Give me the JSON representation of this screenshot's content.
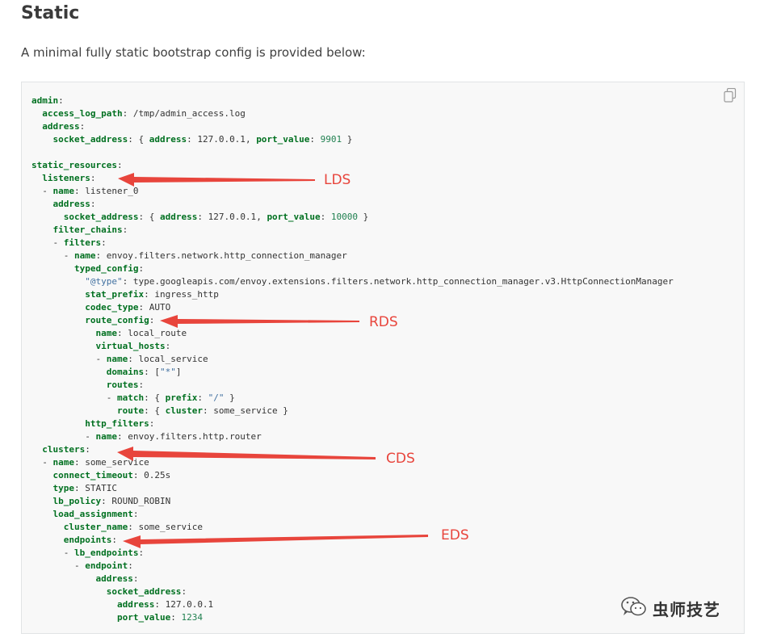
{
  "heading": "Static",
  "intro": "A minimal fully static bootstrap config is provided below:",
  "code_lines": [
    [
      [
        "k",
        "admin"
      ],
      [
        "p",
        ":"
      ]
    ],
    [
      [
        "p",
        "  "
      ],
      [
        "k",
        "access_log_path"
      ],
      [
        "p",
        ": "
      ],
      [
        "v",
        "/tmp/admin_access.log"
      ]
    ],
    [
      [
        "p",
        "  "
      ],
      [
        "k",
        "address"
      ],
      [
        "p",
        ":"
      ]
    ],
    [
      [
        "p",
        "    "
      ],
      [
        "k",
        "socket_address"
      ],
      [
        "p",
        ": { "
      ],
      [
        "k",
        "address"
      ],
      [
        "p",
        ": "
      ],
      [
        "v",
        "127.0.0.1"
      ],
      [
        "p",
        ", "
      ],
      [
        "k",
        "port_value"
      ],
      [
        "p",
        ": "
      ],
      [
        "n",
        "9901"
      ],
      [
        "p",
        " }"
      ]
    ],
    [],
    [
      [
        "k",
        "static_resources"
      ],
      [
        "p",
        ":"
      ]
    ],
    [
      [
        "p",
        "  "
      ],
      [
        "k",
        "listeners"
      ],
      [
        "p",
        ":"
      ]
    ],
    [
      [
        "p",
        "  - "
      ],
      [
        "k",
        "name"
      ],
      [
        "p",
        ": "
      ],
      [
        "v",
        "listener_0"
      ]
    ],
    [
      [
        "p",
        "    "
      ],
      [
        "k",
        "address"
      ],
      [
        "p",
        ":"
      ]
    ],
    [
      [
        "p",
        "      "
      ],
      [
        "k",
        "socket_address"
      ],
      [
        "p",
        ": { "
      ],
      [
        "k",
        "address"
      ],
      [
        "p",
        ": "
      ],
      [
        "v",
        "127.0.0.1"
      ],
      [
        "p",
        ", "
      ],
      [
        "k",
        "port_value"
      ],
      [
        "p",
        ": "
      ],
      [
        "n",
        "10000"
      ],
      [
        "p",
        " }"
      ]
    ],
    [
      [
        "p",
        "    "
      ],
      [
        "k",
        "filter_chains"
      ],
      [
        "p",
        ":"
      ]
    ],
    [
      [
        "p",
        "    - "
      ],
      [
        "k",
        "filters"
      ],
      [
        "p",
        ":"
      ]
    ],
    [
      [
        "p",
        "      - "
      ],
      [
        "k",
        "name"
      ],
      [
        "p",
        ": "
      ],
      [
        "v",
        "envoy.filters.network.http_connection_manager"
      ]
    ],
    [
      [
        "p",
        "        "
      ],
      [
        "k",
        "typed_config"
      ],
      [
        "p",
        ":"
      ]
    ],
    [
      [
        "p",
        "          "
      ],
      [
        "s",
        "\"@type\""
      ],
      [
        "p",
        ": "
      ],
      [
        "v",
        "type.googleapis.com/envoy.extensions.filters.network.http_connection_manager.v3.HttpConnectionManager"
      ]
    ],
    [
      [
        "p",
        "          "
      ],
      [
        "k",
        "stat_prefix"
      ],
      [
        "p",
        ": "
      ],
      [
        "v",
        "ingress_http"
      ]
    ],
    [
      [
        "p",
        "          "
      ],
      [
        "k",
        "codec_type"
      ],
      [
        "p",
        ": "
      ],
      [
        "v",
        "AUTO"
      ]
    ],
    [
      [
        "p",
        "          "
      ],
      [
        "k",
        "route_config"
      ],
      [
        "p",
        ":"
      ]
    ],
    [
      [
        "p",
        "            "
      ],
      [
        "k",
        "name"
      ],
      [
        "p",
        ": "
      ],
      [
        "v",
        "local_route"
      ]
    ],
    [
      [
        "p",
        "            "
      ],
      [
        "k",
        "virtual_hosts"
      ],
      [
        "p",
        ":"
      ]
    ],
    [
      [
        "p",
        "            - "
      ],
      [
        "k",
        "name"
      ],
      [
        "p",
        ": "
      ],
      [
        "v",
        "local_service"
      ]
    ],
    [
      [
        "p",
        "              "
      ],
      [
        "k",
        "domains"
      ],
      [
        "p",
        ": ["
      ],
      [
        "s",
        "\"*\""
      ],
      [
        "p",
        "]"
      ]
    ],
    [
      [
        "p",
        "              "
      ],
      [
        "k",
        "routes"
      ],
      [
        "p",
        ":"
      ]
    ],
    [
      [
        "p",
        "              - "
      ],
      [
        "k",
        "match"
      ],
      [
        "p",
        ": { "
      ],
      [
        "k",
        "prefix"
      ],
      [
        "p",
        ": "
      ],
      [
        "s",
        "\"/\""
      ],
      [
        "p",
        " }"
      ]
    ],
    [
      [
        "p",
        "                "
      ],
      [
        "k",
        "route"
      ],
      [
        "p",
        ": { "
      ],
      [
        "k",
        "cluster"
      ],
      [
        "p",
        ": "
      ],
      [
        "v",
        "some_service"
      ],
      [
        "p",
        " }"
      ]
    ],
    [
      [
        "p",
        "          "
      ],
      [
        "k",
        "http_filters"
      ],
      [
        "p",
        ":"
      ]
    ],
    [
      [
        "p",
        "          - "
      ],
      [
        "k",
        "name"
      ],
      [
        "p",
        ": "
      ],
      [
        "v",
        "envoy.filters.http.router"
      ]
    ],
    [
      [
        "p",
        "  "
      ],
      [
        "k",
        "clusters"
      ],
      [
        "p",
        ":"
      ]
    ],
    [
      [
        "p",
        "  - "
      ],
      [
        "k",
        "name"
      ],
      [
        "p",
        ": "
      ],
      [
        "v",
        "some_service"
      ]
    ],
    [
      [
        "p",
        "    "
      ],
      [
        "k",
        "connect_timeout"
      ],
      [
        "p",
        ": "
      ],
      [
        "v",
        "0.25s"
      ]
    ],
    [
      [
        "p",
        "    "
      ],
      [
        "k",
        "type"
      ],
      [
        "p",
        ": "
      ],
      [
        "v",
        "STATIC"
      ]
    ],
    [
      [
        "p",
        "    "
      ],
      [
        "k",
        "lb_policy"
      ],
      [
        "p",
        ": "
      ],
      [
        "v",
        "ROUND_ROBIN"
      ]
    ],
    [
      [
        "p",
        "    "
      ],
      [
        "k",
        "load_assignment"
      ],
      [
        "p",
        ":"
      ]
    ],
    [
      [
        "p",
        "      "
      ],
      [
        "k",
        "cluster_name"
      ],
      [
        "p",
        ": "
      ],
      [
        "v",
        "some_service"
      ]
    ],
    [
      [
        "p",
        "      "
      ],
      [
        "k",
        "endpoints"
      ],
      [
        "p",
        ":"
      ]
    ],
    [
      [
        "p",
        "      - "
      ],
      [
        "k",
        "lb_endpoints"
      ],
      [
        "p",
        ":"
      ]
    ],
    [
      [
        "p",
        "        - "
      ],
      [
        "k",
        "endpoint"
      ],
      [
        "p",
        ":"
      ]
    ],
    [
      [
        "p",
        "            "
      ],
      [
        "k",
        "address"
      ],
      [
        "p",
        ":"
      ]
    ],
    [
      [
        "p",
        "              "
      ],
      [
        "k",
        "socket_address"
      ],
      [
        "p",
        ":"
      ]
    ],
    [
      [
        "p",
        "                "
      ],
      [
        "k",
        "address"
      ],
      [
        "p",
        ": "
      ],
      [
        "v",
        "127.0.0.1"
      ]
    ],
    [
      [
        "p",
        "                "
      ],
      [
        "k",
        "port_value"
      ],
      [
        "p",
        ": "
      ],
      [
        "n",
        "1234"
      ]
    ]
  ],
  "annotations": {
    "lds": "LDS",
    "rds": "RDS",
    "cds": "CDS",
    "eds": "EDS"
  },
  "watermark": {
    "text": "虫师技艺",
    "icon": "wechat-icon"
  },
  "colors": {
    "annotation": "#e8453c",
    "code_background": "#f8f8f8",
    "key": "#007020",
    "string": "#4070a0",
    "number": "#208050"
  }
}
